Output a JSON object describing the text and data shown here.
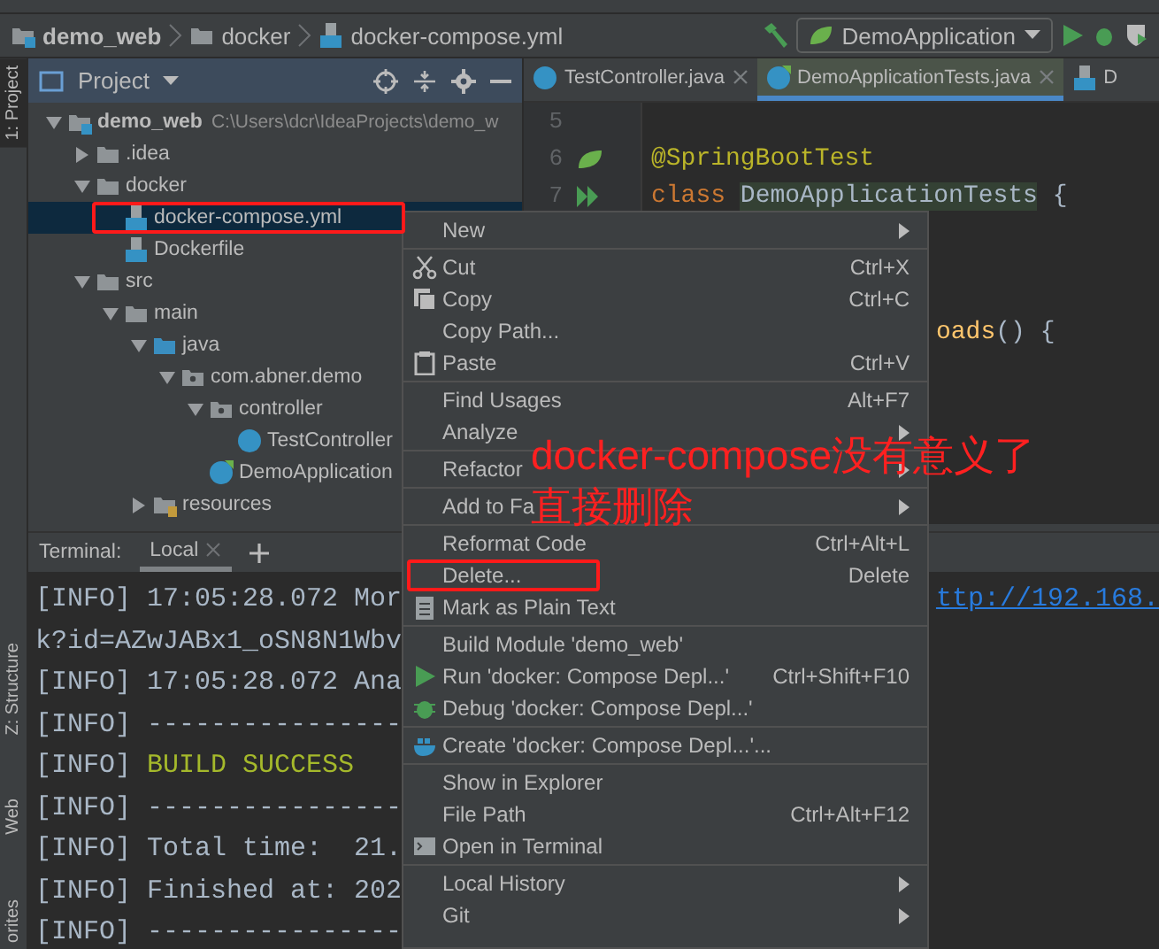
{
  "nav": {
    "breadcrumbs": [
      "demo_web",
      "docker",
      "docker-compose.yml"
    ],
    "run_config": "DemoApplication"
  },
  "side_stripe": {
    "top": [
      {
        "label": "1: Project",
        "selected": true
      }
    ],
    "bottom": [
      {
        "label": "Z: Structure",
        "selected": false
      },
      {
        "label": "Web",
        "selected": false
      },
      {
        "label": "orites",
        "selected": false
      }
    ]
  },
  "project_panel": {
    "title": "Project",
    "tree": [
      {
        "label": "demo_web",
        "hint": "C:\\Users\\dcr\\IdeaProjects\\demo_w",
        "kind": "module",
        "expanded": true,
        "selected": false,
        "children": [
          {
            "label": ".idea",
            "kind": "folder",
            "expanded": false,
            "selected": false
          },
          {
            "label": "docker",
            "kind": "folder",
            "expanded": true,
            "selected": false,
            "children": [
              {
                "label": "docker-compose.yml",
                "kind": "compose-file",
                "selected": true
              },
              {
                "label": "Dockerfile",
                "kind": "docker-file",
                "selected": false
              }
            ]
          },
          {
            "label": "src",
            "kind": "folder",
            "expanded": true,
            "selected": false,
            "children": [
              {
                "label": "main",
                "kind": "folder",
                "expanded": true,
                "selected": false,
                "children": [
                  {
                    "label": "java",
                    "kind": "source-folder",
                    "expanded": true,
                    "selected": false,
                    "children": [
                      {
                        "label": "com.abner.demo",
                        "kind": "package",
                        "expanded": true,
                        "selected": false,
                        "children": [
                          {
                            "label": "controller",
                            "kind": "package",
                            "expanded": true,
                            "selected": false,
                            "children": [
                              {
                                "label": "TestController",
                                "kind": "class",
                                "selected": false
                              }
                            ]
                          },
                          {
                            "label": "DemoApplication",
                            "kind": "spring-class",
                            "selected": false
                          }
                        ]
                      }
                    ]
                  },
                  {
                    "label": "resources",
                    "kind": "resources-folder",
                    "expanded": false,
                    "selected": false
                  }
                ]
              }
            ]
          }
        ]
      }
    ]
  },
  "editor": {
    "tabs": [
      {
        "label": "TestController.java",
        "selected": false,
        "closable": true
      },
      {
        "label": "DemoApplicationTests.java",
        "selected": true,
        "closable": true
      },
      {
        "label": "D",
        "selected": false,
        "closable": false
      }
    ],
    "lines": [
      {
        "number": "5"
      },
      {
        "number": "6",
        "kind": "spring",
        "tokens": [
          {
            "text": "@SpringBootTest",
            "kind": "annotation"
          }
        ]
      },
      {
        "number": "7",
        "kind": "run",
        "tokens": [
          {
            "text": "class ",
            "kind": "keyword"
          },
          {
            "text": "DemoApplicationTests",
            "kind": "ident"
          },
          {
            "text": " {",
            "kind": "punct"
          }
        ]
      },
      {
        "clipped": true,
        "tokens": [
          {
            "text": "oads",
            "kind": "method"
          },
          {
            "text": "() {",
            "kind": "punct"
          }
        ]
      }
    ]
  },
  "terminal": {
    "title": "Terminal:",
    "tabs": [
      {
        "label": "Local",
        "selected": true
      }
    ],
    "lines": [
      {
        "prefix": "[INFO]",
        "text": "17:05:28.072 Mor",
        "tail": "ttp://192.168.",
        "kind": "info"
      },
      {
        "text": "k?id=AZwJABx1_oSN8N1Wbv",
        "kind": "info"
      },
      {
        "prefix": "[INFO]",
        "text": "17:05:28.072 Ana",
        "kind": "info"
      },
      {
        "prefix": "[INFO]",
        "text": "----------------",
        "kind": "info"
      },
      {
        "prefix": "[INFO]",
        "text": "BUILD SUCCESS",
        "kind": "success"
      },
      {
        "prefix": "[INFO]",
        "text": "----------------",
        "kind": "info"
      },
      {
        "prefix": "[INFO]",
        "text": "Total time:  21.",
        "kind": "info"
      },
      {
        "prefix": "[INFO]",
        "text": "Finished at: 202",
        "kind": "info"
      },
      {
        "prefix": "[INFO]",
        "text": "----------------",
        "kind": "info"
      }
    ]
  },
  "context_menu": {
    "groups": [
      [
        {
          "label": "New",
          "submenu": true
        }
      ],
      [
        {
          "label": "Cut",
          "shortcut": "Ctrl+X",
          "kind": "cut"
        },
        {
          "label": "Copy",
          "shortcut": "Ctrl+C",
          "kind": "copy"
        },
        {
          "label": "Copy Path..."
        },
        {
          "label": "Paste",
          "shortcut": "Ctrl+V",
          "kind": "paste"
        }
      ],
      [
        {
          "label": "Find Usages",
          "shortcut": "Alt+F7"
        },
        {
          "label": "Analyze",
          "submenu": true
        }
      ],
      [
        {
          "label": "Refactor",
          "submenu": true
        }
      ],
      [
        {
          "label": "Add to Fa",
          "submenu": true
        }
      ],
      [
        {
          "label": "Reformat Code",
          "shortcut": "Ctrl+Alt+L"
        },
        {
          "label": "Delete...",
          "shortcut": "Delete"
        },
        {
          "label": "Mark as Plain Text",
          "kind": "plain-text"
        }
      ],
      [
        {
          "label": "Build Module 'demo_web'"
        },
        {
          "label": "Run 'docker: Compose Depl...'",
          "shortcut": "Ctrl+Shift+F10",
          "kind": "run"
        },
        {
          "label": "Debug 'docker: Compose Depl...'",
          "kind": "debug"
        }
      ],
      [
        {
          "label": "Create 'docker: Compose Depl...'...",
          "kind": "docker"
        }
      ],
      [
        {
          "label": "Show in Explorer"
        },
        {
          "label": "File Path",
          "shortcut": "Ctrl+Alt+F12"
        },
        {
          "label": "Open in Terminal",
          "kind": "terminal"
        }
      ],
      [
        {
          "label": "Local History",
          "submenu": true
        },
        {
          "label": "Git",
          "submenu": true
        }
      ]
    ]
  },
  "annotation": {
    "lines": [
      "docker-compose没有意义了",
      "直接删除"
    ]
  }
}
